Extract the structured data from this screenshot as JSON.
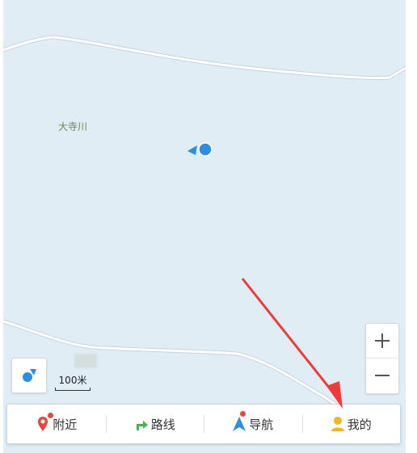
{
  "map": {
    "place_label": "大寺川",
    "background_color": "#e1edf4",
    "road_color": "#ffffff",
    "road_edge_color": "#c9d3da",
    "marker_color": "#2e8de0"
  },
  "scale": {
    "label": "100米"
  },
  "zoom": {
    "in_icon": "plus-icon",
    "out_icon": "minus-icon"
  },
  "locate": {
    "icon": "compass-locate-icon"
  },
  "nav": {
    "items": [
      {
        "label": "附近",
        "icon": "nearby-pin-icon",
        "color": "#e5493b",
        "badge": true
      },
      {
        "label": "路线",
        "icon": "route-arrow-icon",
        "color": "#4caf50",
        "badge": false
      },
      {
        "label": "导航",
        "icon": "navigation-arrow-icon",
        "color": "#2e8de0",
        "badge": true
      },
      {
        "label": "我的",
        "icon": "user-icon",
        "color": "#f0b429",
        "badge": false
      }
    ]
  },
  "annotation": {
    "arrow_color": "#f03a3a"
  }
}
